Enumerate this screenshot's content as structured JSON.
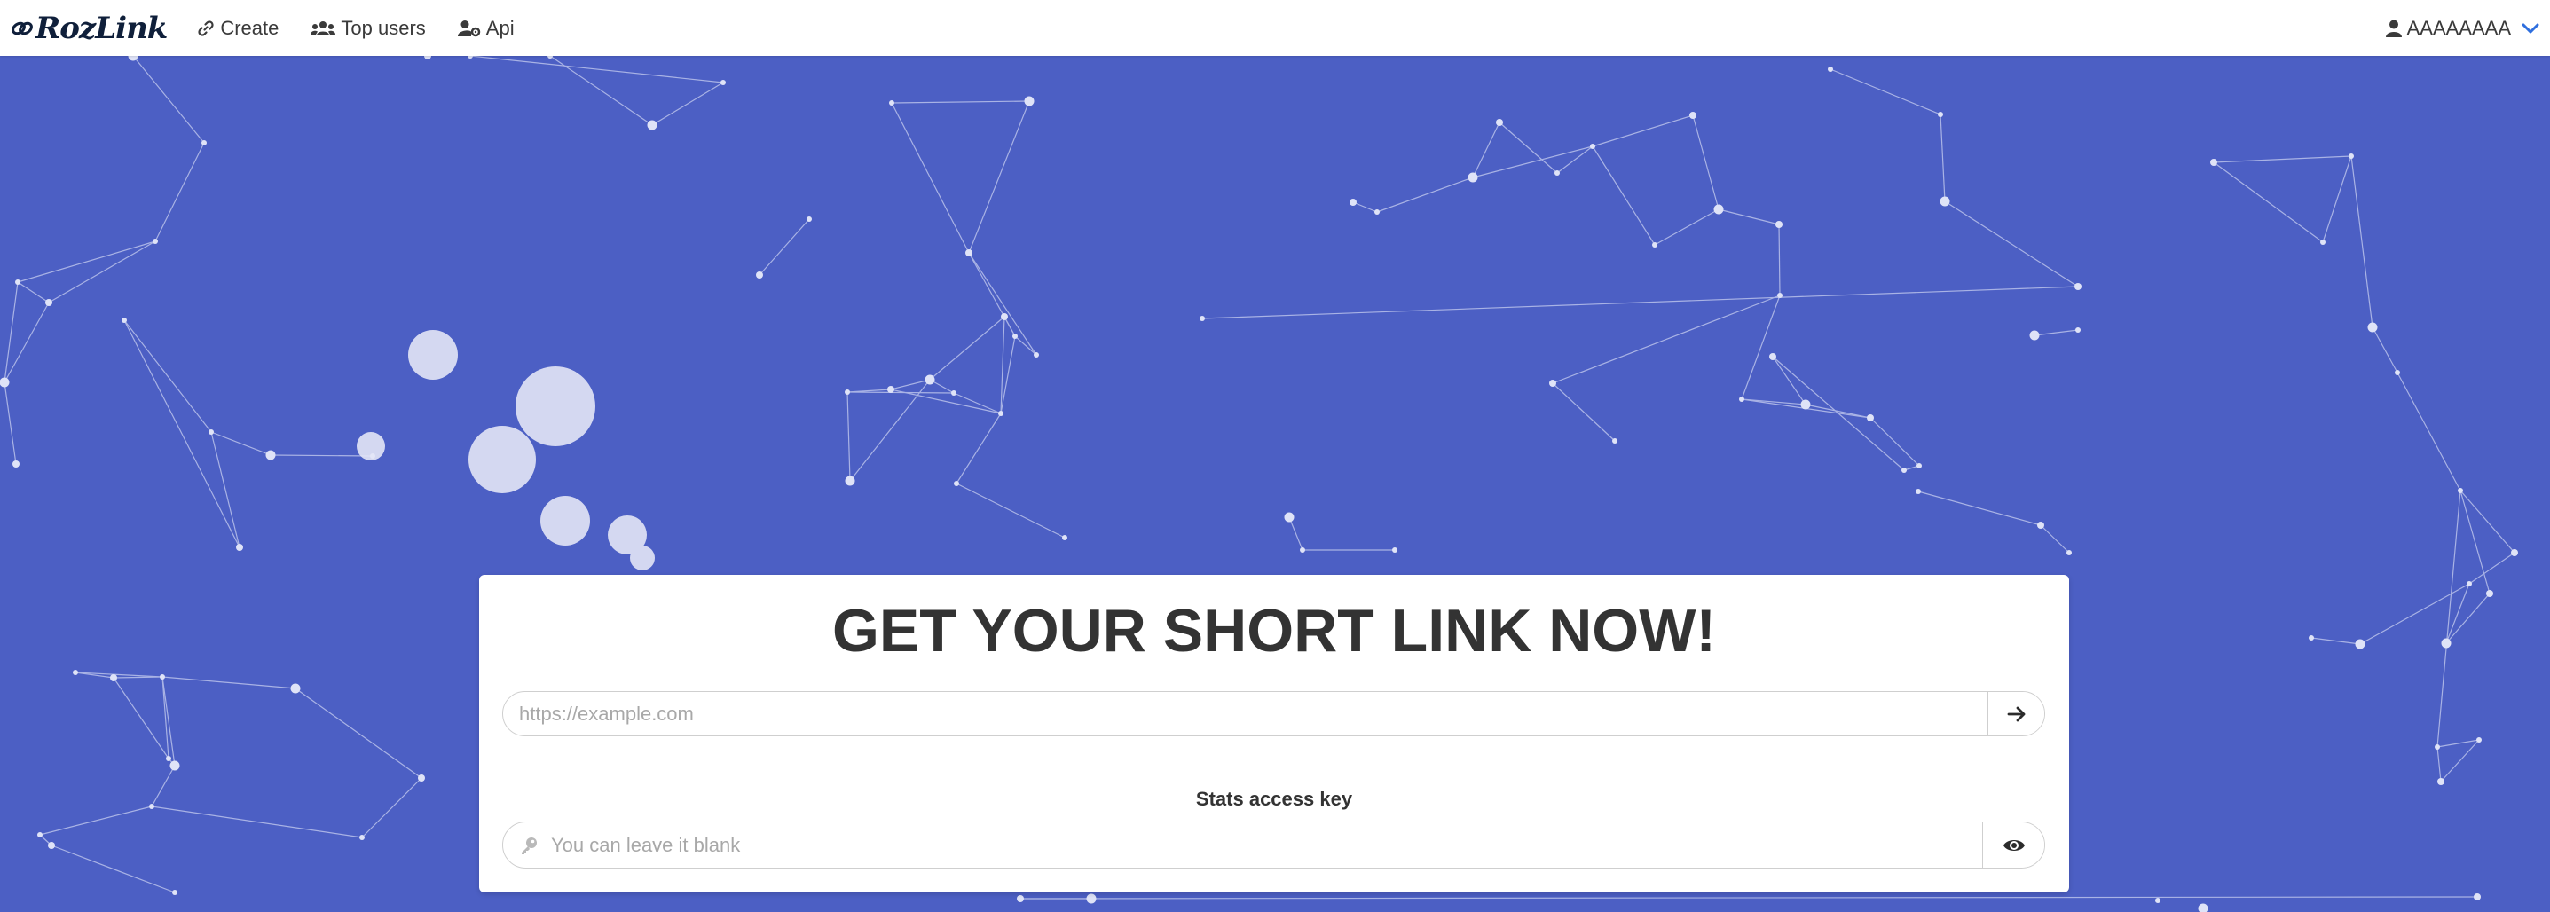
{
  "brand": {
    "logo_text": "RozLink"
  },
  "nav": {
    "items": [
      {
        "label": "Create",
        "icon": "link-icon"
      },
      {
        "label": "Top users",
        "icon": "users-icon"
      },
      {
        "label": "Api",
        "icon": "user-cog-icon"
      }
    ],
    "user": {
      "name": "AAAAAAAA",
      "icon": "user-icon"
    }
  },
  "hero": {
    "title": "GET YOUR SHORT LINK NOW!",
    "url_placeholder": "https://example.com",
    "url_value": "",
    "submit_icon": "arrow-right-icon",
    "stats_key_label": "Stats access key",
    "stats_key_placeholder": "You can leave it blank",
    "stats_key_value": "",
    "key_icon": "key-icon",
    "toggle_icon": "eye-icon"
  },
  "colors": {
    "background": "#4c5fc4",
    "card": "#ffffff",
    "text": "#333333",
    "accent": "#2f6fde",
    "network": "#dfe3f7"
  }
}
